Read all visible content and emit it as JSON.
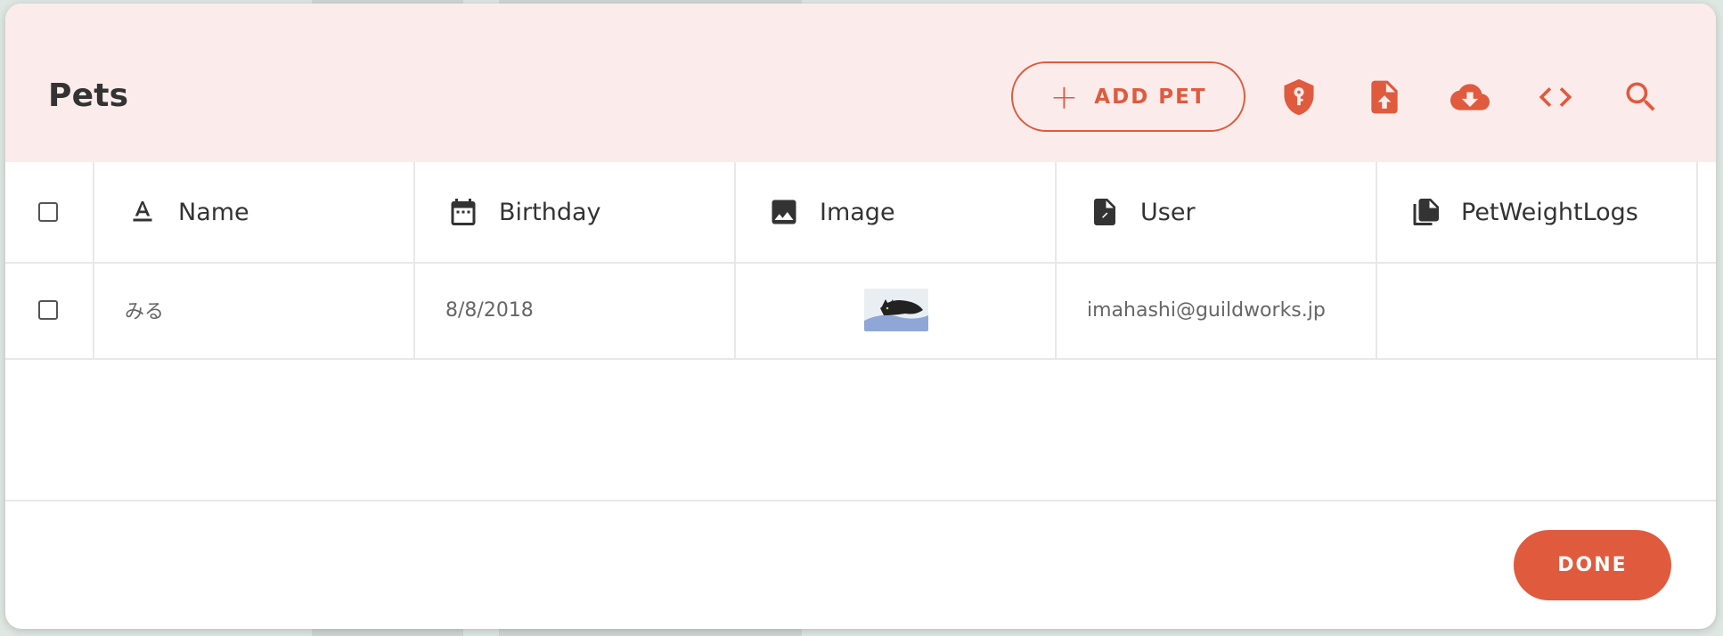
{
  "dialog": {
    "title": "Pets",
    "add_button_label": "ADD PET",
    "done_button_label": "DONE"
  },
  "toolbar_icons": [
    "shield-key-icon",
    "file-upload-icon",
    "cloud-download-icon",
    "code-icon",
    "search-icon"
  ],
  "table": {
    "columns": [
      {
        "label": "Name",
        "icon": "text-format-icon"
      },
      {
        "label": "Birthday",
        "icon": "calendar-icon"
      },
      {
        "label": "Image",
        "icon": "image-icon"
      },
      {
        "label": "User",
        "icon": "file-link-icon"
      },
      {
        "label": "PetWeightLogs",
        "icon": "file-multiple-link-icon"
      }
    ],
    "rows": [
      {
        "name": "みる",
        "birthday": "8/8/2018",
        "image": "cat-photo",
        "user": "imahashi@guildworks.jp",
        "petweightlogs": ""
      }
    ]
  },
  "colors": {
    "accent": "#e05a3d",
    "header_bg": "#fbeceb",
    "icon_dark": "#333333"
  }
}
